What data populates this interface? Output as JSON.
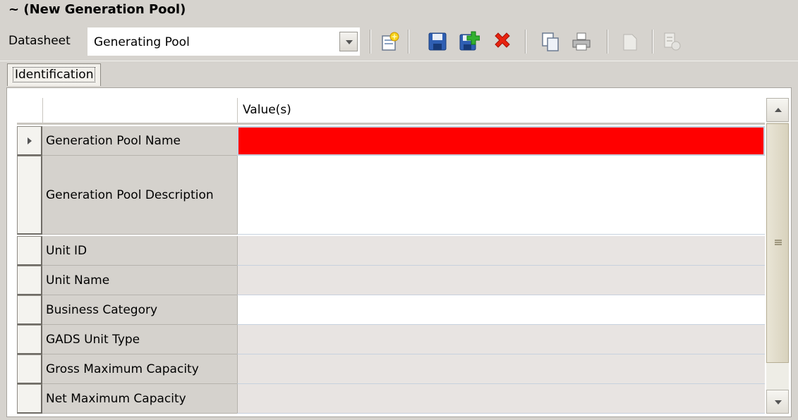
{
  "header": {
    "title": "~ (New Generation Pool)"
  },
  "toolbar": {
    "datasheet_label": "Datasheet",
    "datasheet_value": "Generating Pool",
    "icons": [
      "new-record-icon",
      "save-icon",
      "save-and-new-icon",
      "delete-icon",
      "copy-icon",
      "print-icon",
      "disabled-page-icon",
      "disabled-document-icon"
    ]
  },
  "tabs": [
    {
      "label": "Identification",
      "active": true
    }
  ],
  "grid": {
    "column_header": "Value(s)",
    "rows": [
      {
        "label": "Generation Pool Name",
        "state": "required",
        "current": true
      },
      {
        "label": "Generation Pool Description",
        "state": "editable"
      },
      {
        "label": "Unit ID",
        "state": "readonly"
      },
      {
        "label": "Unit Name",
        "state": "readonly"
      },
      {
        "label": "Business Category",
        "state": "editable"
      },
      {
        "label": "GADS Unit Type",
        "state": "readonly"
      },
      {
        "label": "Gross Maximum Capacity",
        "state": "readonly"
      },
      {
        "label": "Net Maximum Capacity",
        "state": "readonly"
      }
    ]
  },
  "colors": {
    "required": "#ff0000",
    "readonly": "#e8e4e2",
    "editable": "#ffffff",
    "label_bg": "#d5d2cd"
  }
}
